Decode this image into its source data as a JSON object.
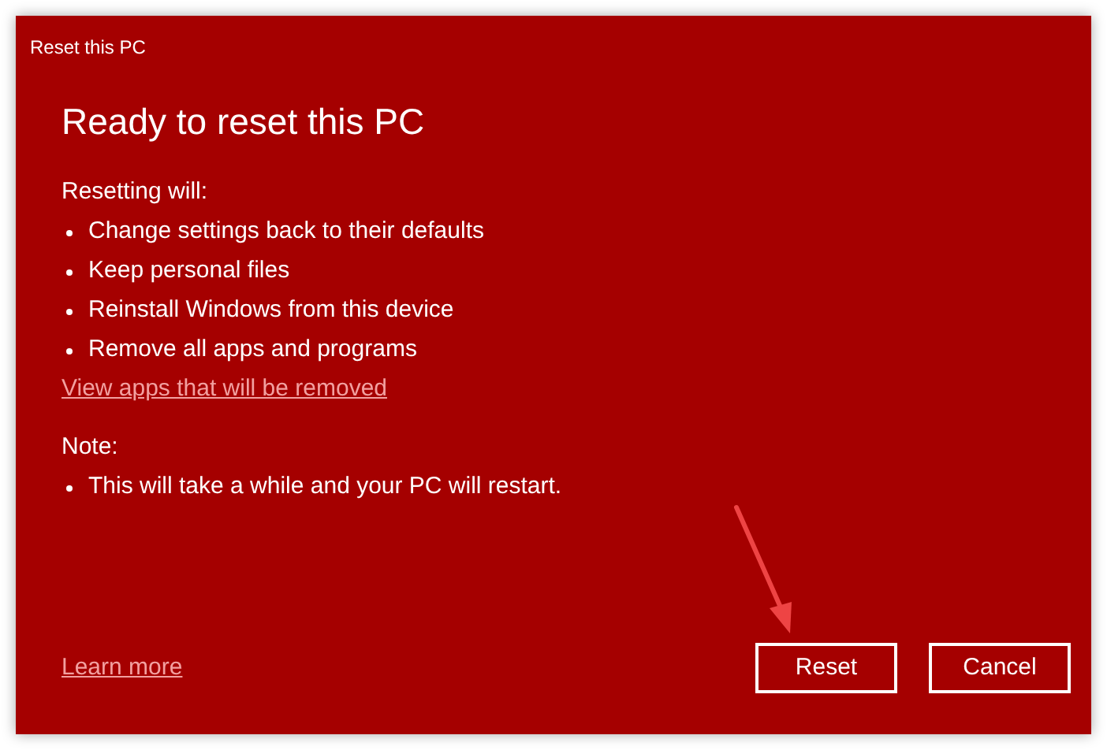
{
  "window": {
    "title": "Reset this PC"
  },
  "heading": "Ready to reset this PC",
  "intro": "Resetting will:",
  "bullets": [
    "Change settings back to their defaults",
    "Keep personal files",
    "Reinstall Windows from this device",
    "Remove all apps and programs"
  ],
  "link": "View apps that will be removed",
  "note": {
    "label": "Note:",
    "bullets": [
      "This will take a while and your PC will restart."
    ]
  },
  "footer": {
    "link": "Learn more",
    "buttons": [
      {
        "label": "Reset"
      },
      {
        "label": "Cancel"
      }
    ]
  }
}
